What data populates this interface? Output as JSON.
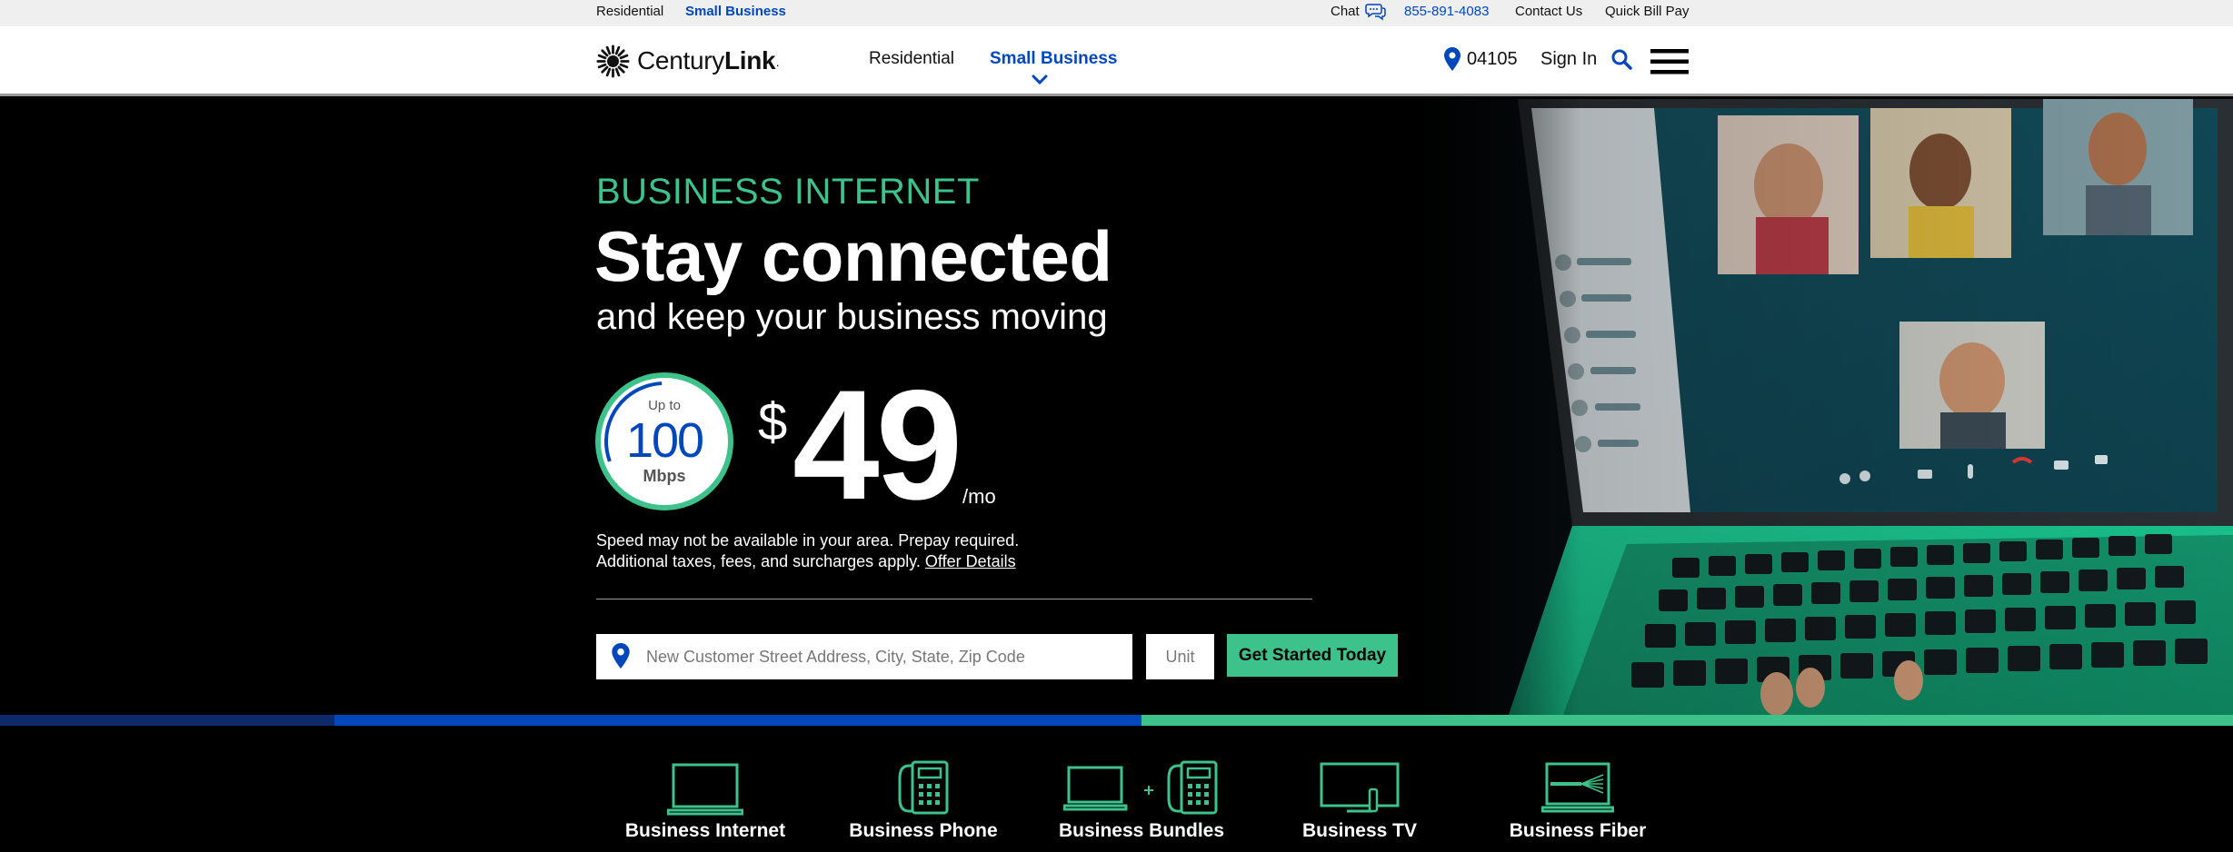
{
  "utility_bar": {
    "residential": "Residential",
    "small_business": "Small Business",
    "chat": "Chat",
    "phone": "855-891-4083",
    "contact": "Contact Us",
    "bill_pay": "Quick Bill Pay"
  },
  "header": {
    "logo_text_light": "Century",
    "logo_text_bold": "Link",
    "logo_mark": "·",
    "nav_residential": "Residential",
    "nav_small_business": "Small Business",
    "zip": "04105",
    "sign_in": "Sign In"
  },
  "hero": {
    "eyebrow": "BUSINESS INTERNET",
    "headline": "Stay connected",
    "subhead": "and keep your business moving",
    "speed_prefix": "Up to",
    "speed_value": "100",
    "speed_unit": "Mbps",
    "price_currency": "$",
    "price": "49",
    "price_period": "/mo",
    "disclaimer_line1": "Speed may not be available in your area. Prepay required.",
    "disclaimer_line2": "Additional taxes, fees, and surcharges apply. ",
    "offer_link": "Offer Details",
    "address_placeholder": "New Customer Street Address, City, State, Zip Code",
    "unit_placeholder": "Unit",
    "cta": "Get Started Today"
  },
  "products": [
    {
      "label": "Business Internet",
      "icon": "laptop-icon"
    },
    {
      "label": "Business Phone",
      "icon": "desk-phone-icon"
    },
    {
      "label": "Business Bundles",
      "icon": "laptop-plus-phone-icon"
    },
    {
      "label": "Business TV",
      "icon": "tv-icon"
    },
    {
      "label": "Business Fiber",
      "icon": "fiber-laptop-icon"
    }
  ],
  "colors": {
    "brand_blue": "#0047bb",
    "brand_green": "#3ec28b",
    "stripe": [
      "#0e2a6b",
      "#0047bb",
      "#3ec28b"
    ]
  }
}
